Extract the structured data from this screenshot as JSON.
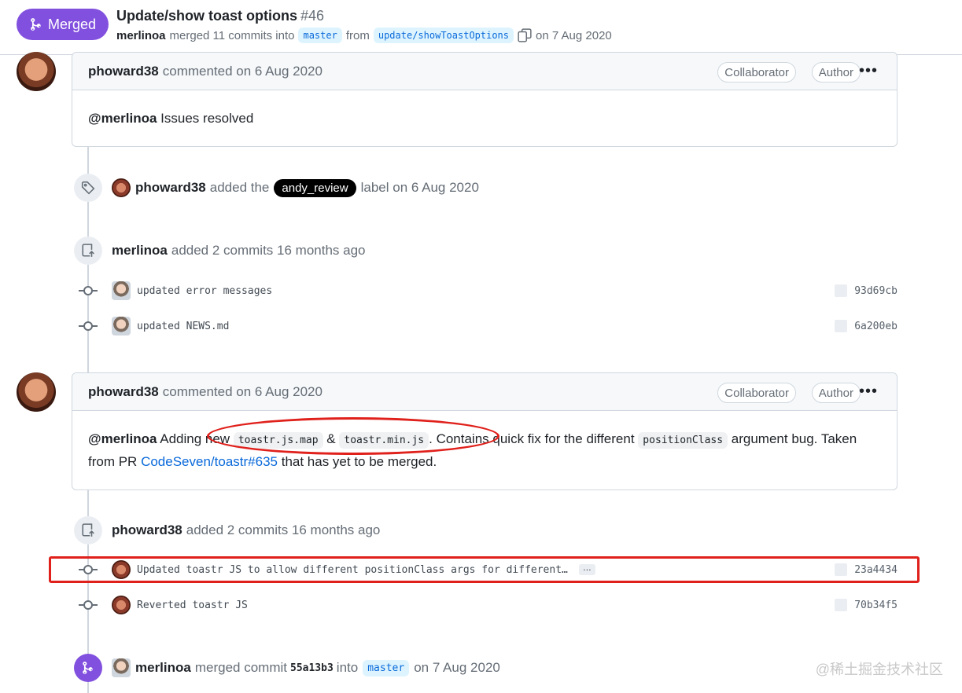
{
  "header": {
    "status": "Merged",
    "title": "Update/show toast options",
    "number": "#46",
    "author": "merlinoa",
    "action": "merged 11 commits into",
    "base_branch": "master",
    "from_word": "from",
    "head_branch": "update/showToastOptions",
    "date": "on 7 Aug 2020"
  },
  "comment1": {
    "author": "phoward38",
    "date": "commented on 6 Aug 2020",
    "badge1": "Collaborator",
    "badge2": "Author",
    "mention": "@merlinoa",
    "text": "Issues resolved"
  },
  "label_event": {
    "author": "phoward38",
    "pre": "added the",
    "label": "andy_review",
    "post": "label on 6 Aug 2020"
  },
  "commits_event1": {
    "author": "merlinoa",
    "text": "added 2 commits 16 months ago",
    "commits": [
      {
        "message": "updated error messages",
        "sha": "93d69cb"
      },
      {
        "message": "updated NEWS.md",
        "sha": "6a200eb"
      }
    ]
  },
  "comment2": {
    "author": "phoward38",
    "date": "commented on 6 Aug 2020",
    "badge1": "Collaborator",
    "badge2": "Author",
    "mention": "@merlinoa",
    "t1": "Adding new",
    "code1": "toastr.js.map",
    "amp": "&",
    "code2": "toastr.min.js",
    "t2": ". Contains quick fix for the different",
    "code3": "positionClass",
    "t3": "argument bug. Taken from PR",
    "link": "CodeSeven/toastr#635",
    "t4": "that has yet to be merged."
  },
  "commits_event2": {
    "author": "phoward38",
    "text": "added 2 commits 16 months ago",
    "commits": [
      {
        "message": "Updated toastr JS to allow different positionClass args for different…",
        "sha": "23a4434",
        "more": "…"
      },
      {
        "message": "Reverted toastr JS",
        "sha": "70b34f5"
      }
    ]
  },
  "merge_event": {
    "author": "merlinoa",
    "pre": "merged commit",
    "sha": "55a13b3",
    "into": "into",
    "branch": "master",
    "date": "on 7 Aug 2020"
  },
  "watermark": "@稀土掘金技术社区",
  "colors": {
    "merged": "#8250df",
    "annotation": "#e0201b",
    "link": "#0969da"
  }
}
